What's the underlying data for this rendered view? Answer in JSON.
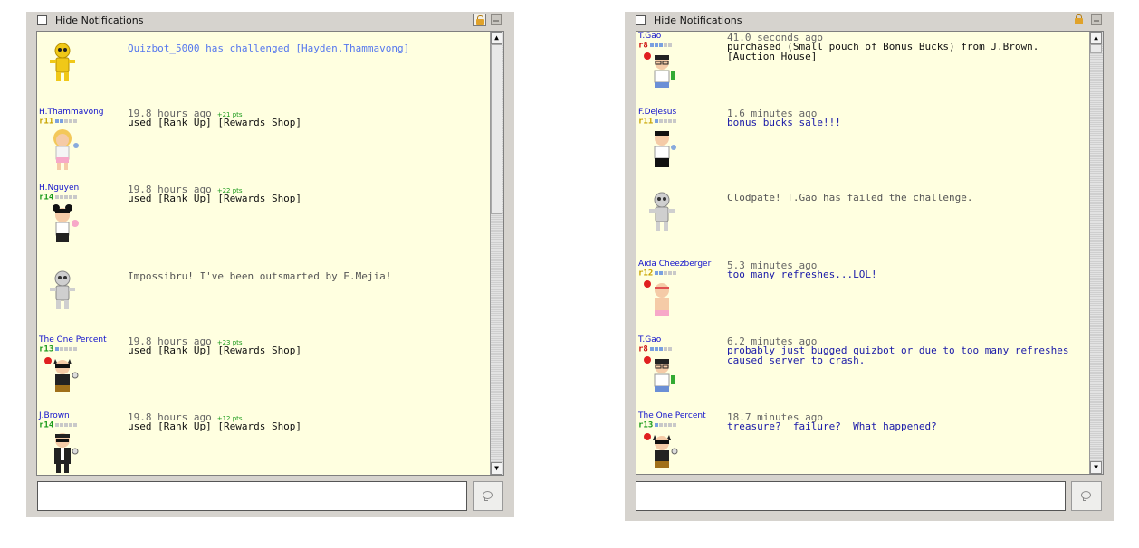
{
  "colors": {
    "panel": "#d6d3ce",
    "feed": "#ffffe0",
    "username": "#1111cc",
    "points": "#1a9a1a",
    "message_blue": "#1a1aa8"
  },
  "panels": [
    {
      "hide_label": "Hide Notifications",
      "messages": [
        {
          "type": "system",
          "avatar": "yellow-robot",
          "body": "Quizbot_5000 has challenged [Hayden.Thammavong]"
        },
        {
          "type": "user",
          "user": "H.Thammavong",
          "rank": "r11",
          "rank_color": "y",
          "avatar": "blonde-girl",
          "time": "19.8 hours ago",
          "pts": "+21 pts",
          "body": "used [Rank Up] [Rewards Shop]"
        },
        {
          "type": "user",
          "user": "H.Nguyen",
          "rank": "r14",
          "rank_color": "g",
          "avatar": "bun-hair-person",
          "time": "19.8 hours ago",
          "pts": "+22 pts",
          "body": "used [Rank Up] [Rewards Shop]"
        },
        {
          "type": "system",
          "avatar": "gray-robot",
          "body": "Impossibru! I've been outsmarted by E.Mejia!"
        },
        {
          "type": "user",
          "user": "The One Percent",
          "rank": "r13",
          "rank_color": "g",
          "avatar": "masked-cat",
          "time": "19.8 hours ago",
          "pts": "+23 pts",
          "body": "used [Rank Up] [Rewards Shop]"
        },
        {
          "type": "user",
          "user": "J.Brown",
          "rank": "r14",
          "rank_color": "g",
          "avatar": "suited-man",
          "time": "19.8 hours ago",
          "pts": "+12 pts",
          "body": "used [Rank Up] [Rewards Shop]"
        }
      ]
    },
    {
      "hide_label": "Hide Notifications",
      "messages": [
        {
          "type": "user",
          "user": "T.Gao",
          "rank": "r8",
          "rank_color": "r",
          "avatar": "glasses-person",
          "time": "41.0 seconds ago",
          "pts": "",
          "body": "purchased (Small pouch of Bonus Bucks) from J.Brown.\n[Auction House]",
          "style": ""
        },
        {
          "type": "user",
          "user": "F.Dejesus",
          "rank": "r11",
          "rank_color": "y",
          "avatar": "dark-hair-person",
          "time": "1.6 minutes ago",
          "pts": "",
          "body": "bonus bucks sale!!!",
          "style": "blue"
        },
        {
          "type": "system",
          "avatar": "gray-robot",
          "body": "Clodpate! T.Gao has failed the challenge."
        },
        {
          "type": "user",
          "user": "Aida Cheezberger",
          "rank": "r12",
          "rank_color": "y",
          "avatar": "headband-kid",
          "time": "5.3 minutes ago",
          "pts": "",
          "body": "too many refreshes...LOL!",
          "style": "blue"
        },
        {
          "type": "user",
          "user": "T.Gao",
          "rank": "r8",
          "rank_color": "r",
          "avatar": "glasses-person",
          "time": "6.2 minutes ago",
          "pts": "",
          "body": "probably just bugged quizbot or due to too many refreshes\ncaused server to crash.",
          "style": "blue"
        },
        {
          "type": "user",
          "user": "The One Percent",
          "rank": "r13",
          "rank_color": "g",
          "avatar": "masked-cat",
          "time": "18.7 minutes ago",
          "pts": "",
          "body": "treasure?  failure?  What happened?",
          "style": "blue"
        }
      ]
    }
  ]
}
